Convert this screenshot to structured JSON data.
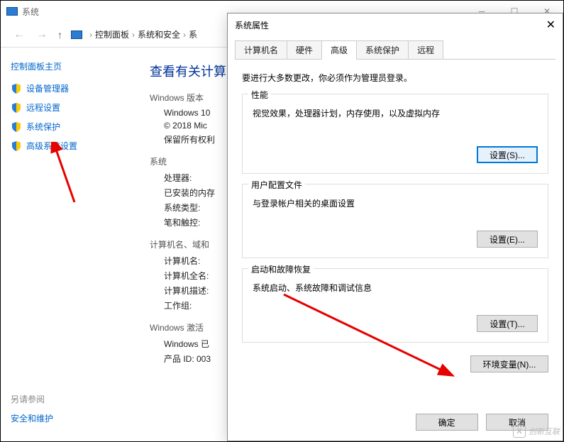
{
  "bg": {
    "title": "系统",
    "breadcrumb": {
      "cp": "控制面板",
      "sec": "系统和安全",
      "sys": "系"
    },
    "sidebar": {
      "home": "控制面板主页",
      "items": [
        {
          "label": "设备管理器"
        },
        {
          "label": "远程设置"
        },
        {
          "label": "系统保护"
        },
        {
          "label": "高级系统设置"
        }
      ],
      "see_also_hdr": "另请参阅",
      "see_also_link": "安全和维护"
    },
    "main": {
      "heading": "查看有关计算",
      "win_edition_hdr": "Windows 版本",
      "win_edition_line": "Windows 10",
      "copyright": "© 2018 Mic",
      "rights": "保留所有权利",
      "system_hdr": "系统",
      "cpu": "处理器:",
      "ram": "已安装的内存",
      "systype": "系统类型:",
      "pen": "笔和触控:",
      "domain_hdr": "计算机名、域和",
      "pcname": "计算机名:",
      "pcfull": "计算机全名:",
      "pcdesc": "计算机描述:",
      "workgroup": "工作组:",
      "act_hdr": "Windows 激活",
      "act_line": "Windows 已",
      "pid": "产品 ID: 003"
    }
  },
  "dialog": {
    "title": "系统属性",
    "tabs": {
      "computer_name": "计算机名",
      "hardware": "硬件",
      "advanced": "高级",
      "protection": "系统保护",
      "remote": "远程"
    },
    "intro": "要进行大多数更改，你必须作为管理员登录。",
    "performance": {
      "legend": "性能",
      "desc": "视觉效果，处理器计划，内存使用，以及虚拟内存",
      "btn": "设置(S)..."
    },
    "profiles": {
      "legend": "用户配置文件",
      "desc": "与登录帐户相关的桌面设置",
      "btn": "设置(E)..."
    },
    "startup": {
      "legend": "启动和故障恢复",
      "desc": "系统启动、系统故障和调试信息",
      "btn": "设置(T)..."
    },
    "env_btn": "环境变量(N)...",
    "ok": "确定",
    "cancel": "取消"
  },
  "watermark": {
    "brand": "创新互联"
  }
}
